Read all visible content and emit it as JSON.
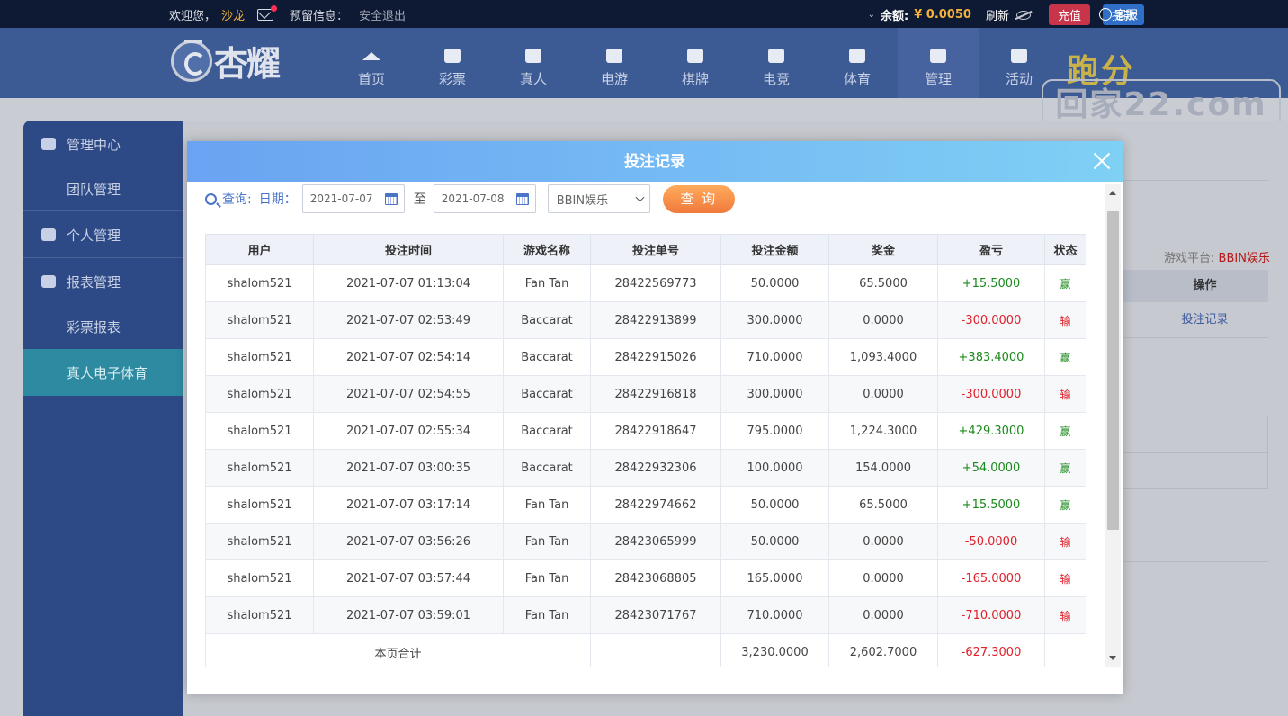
{
  "topbar": {
    "welcome": "欢迎您，",
    "username": "沙龙",
    "reserve_label": "预留信息：",
    "logout": "安全退出",
    "balance_label": "余额:",
    "balance_value": "¥ 0.0050",
    "refresh": "刷新",
    "recharge": "充值",
    "withdraw": "提款",
    "customer_service": "客服"
  },
  "brand": {
    "logo_text": "杏耀"
  },
  "nav": [
    {
      "label": "首页",
      "icon": "home-icon"
    },
    {
      "label": "彩票",
      "icon": "lottery-icon"
    },
    {
      "label": "真人",
      "icon": "live-icon"
    },
    {
      "label": "电游",
      "icon": "slot-icon"
    },
    {
      "label": "棋牌",
      "icon": "cards-icon"
    },
    {
      "label": "电竞",
      "icon": "gamepad-icon"
    },
    {
      "label": "体育",
      "icon": "trophy-icon"
    },
    {
      "label": "管理",
      "icon": "users-icon",
      "active": true
    },
    {
      "label": "活动",
      "icon": "gift-icon"
    }
  ],
  "watermark": {
    "top": "跑分",
    "bottom": "回家22.com"
  },
  "sidebar": {
    "items": [
      {
        "label": "管理中心",
        "type": "head",
        "icon": "users-icon"
      },
      {
        "label": "团队管理",
        "type": "sub"
      },
      {
        "label": "个人管理",
        "type": "head",
        "icon": "person-icon"
      },
      {
        "label": "报表管理",
        "type": "head",
        "icon": "report-icon"
      },
      {
        "label": "彩票报表",
        "type": "sub"
      },
      {
        "label": "真人电子体育",
        "type": "sub",
        "active": true
      }
    ]
  },
  "background": {
    "platform_label": "游戏平台:",
    "platform_value": "BBIN娱乐",
    "op_header": "操作",
    "op_link": "投注记录"
  },
  "modal": {
    "title": "投注记录",
    "query_label": "查询:",
    "date_label": "日期：",
    "date_from": "2021-07-07",
    "to": "至",
    "date_to": "2021-07-08",
    "platform_select": "BBIN娱乐",
    "query_button": "查 询",
    "columns": [
      "用户",
      "投注时间",
      "游戏名称",
      "投注单号",
      "投注金额",
      "奖金",
      "盈亏",
      "状态"
    ],
    "rows": [
      {
        "user": "shalom521",
        "time": "2021-07-07 01:13:04",
        "game": "Fan Tan",
        "order": "28422569773",
        "bet": "50.0000",
        "prize": "65.5000",
        "profit": "+15.5000",
        "status": "赢",
        "win": true
      },
      {
        "user": "shalom521",
        "time": "2021-07-07 02:53:49",
        "game": "Baccarat",
        "order": "28422913899",
        "bet": "300.0000",
        "prize": "0.0000",
        "profit": "-300.0000",
        "status": "输",
        "win": false
      },
      {
        "user": "shalom521",
        "time": "2021-07-07 02:54:14",
        "game": "Baccarat",
        "order": "28422915026",
        "bet": "710.0000",
        "prize": "1,093.4000",
        "profit": "+383.4000",
        "status": "赢",
        "win": true
      },
      {
        "user": "shalom521",
        "time": "2021-07-07 02:54:55",
        "game": "Baccarat",
        "order": "28422916818",
        "bet": "300.0000",
        "prize": "0.0000",
        "profit": "-300.0000",
        "status": "输",
        "win": false
      },
      {
        "user": "shalom521",
        "time": "2021-07-07 02:55:34",
        "game": "Baccarat",
        "order": "28422918647",
        "bet": "795.0000",
        "prize": "1,224.3000",
        "profit": "+429.3000",
        "status": "赢",
        "win": true
      },
      {
        "user": "shalom521",
        "time": "2021-07-07 03:00:35",
        "game": "Baccarat",
        "order": "28422932306",
        "bet": "100.0000",
        "prize": "154.0000",
        "profit": "+54.0000",
        "status": "赢",
        "win": true
      },
      {
        "user": "shalom521",
        "time": "2021-07-07 03:17:14",
        "game": "Fan Tan",
        "order": "28422974662",
        "bet": "50.0000",
        "prize": "65.5000",
        "profit": "+15.5000",
        "status": "赢",
        "win": true
      },
      {
        "user": "shalom521",
        "time": "2021-07-07 03:56:26",
        "game": "Fan Tan",
        "order": "28423065999",
        "bet": "50.0000",
        "prize": "0.0000",
        "profit": "-50.0000",
        "status": "输",
        "win": false
      },
      {
        "user": "shalom521",
        "time": "2021-07-07 03:57:44",
        "game": "Fan Tan",
        "order": "28423068805",
        "bet": "165.0000",
        "prize": "0.0000",
        "profit": "-165.0000",
        "status": "输",
        "win": false
      },
      {
        "user": "shalom521",
        "time": "2021-07-07 03:59:01",
        "game": "Fan Tan",
        "order": "28423071767",
        "bet": "710.0000",
        "prize": "0.0000",
        "profit": "-710.0000",
        "status": "输",
        "win": false
      }
    ],
    "total": {
      "label": "本页合计",
      "bet": "3,230.0000",
      "prize": "2,602.7000",
      "profit": "-627.3000"
    }
  },
  "colors": {
    "win": "#1c8a1c",
    "lose": "#e0202a",
    "accent": "#3c5a94"
  }
}
